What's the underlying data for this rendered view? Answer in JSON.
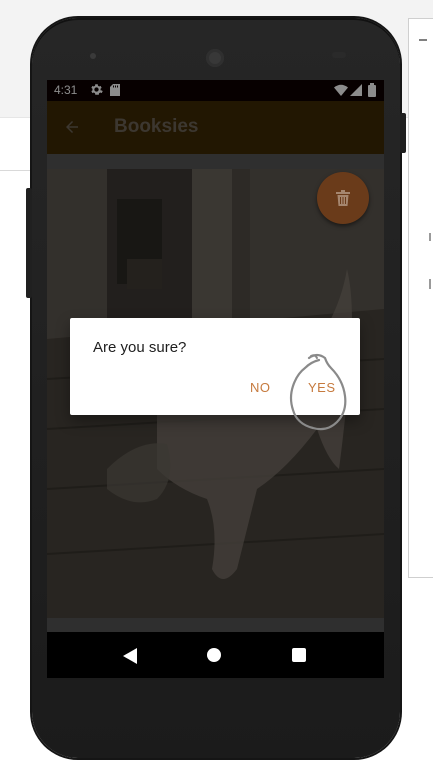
{
  "status_bar": {
    "time": "4:31",
    "icons": [
      "gear-icon",
      "sd-card-icon",
      "wifi-icon",
      "signal-icon",
      "battery-icon"
    ]
  },
  "app_bar": {
    "title": "Booksies",
    "back_icon": "arrow-left-icon",
    "background_color": "#3f2a05"
  },
  "fab": {
    "icon": "trash-icon",
    "color": "#6a3b1a"
  },
  "dialog": {
    "message": "Are you sure?",
    "buttons": {
      "no_label": "NO",
      "yes_label": "YES"
    },
    "accent_color": "#c67a3e"
  },
  "nav_bar": {
    "icons": [
      "back-triangle-icon",
      "home-circle-icon",
      "recent-square-icon"
    ]
  }
}
